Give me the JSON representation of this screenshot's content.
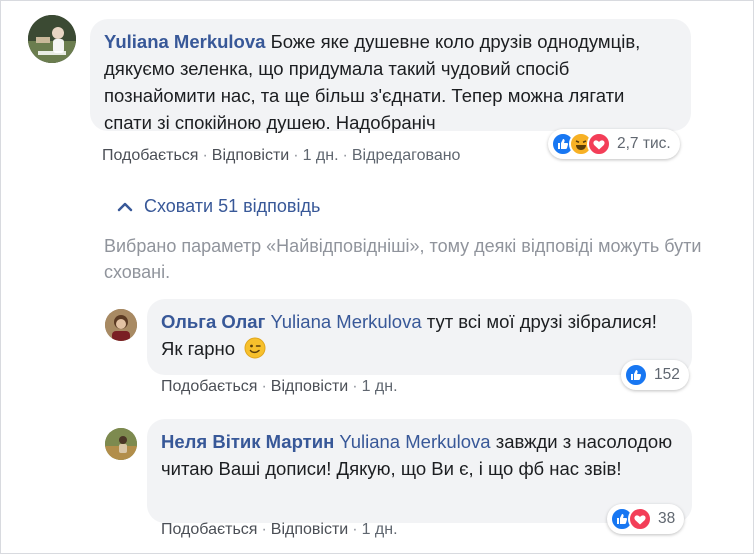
{
  "comment": {
    "author": "Yuliana Merkulova",
    "text": "Боже яке душевне коло друзів однодумців, дякуємо зеленка, що придумала такий чудовий спосіб познайомити нас, та ще більш з'єднати. Тепер можна лягати спати зі спокійною душею. Надобраніч",
    "like_label": "Подобається",
    "reply_label": "Відповісти",
    "time": "1 дн.",
    "edited": "Відредаговано",
    "reaction_count": "2,7 тис.",
    "reaction_icons": [
      "like-icon",
      "haha-icon",
      "love-icon"
    ]
  },
  "replies_toggle": {
    "label": "Сховати 51 відповідь",
    "icon": "chevron-up-icon"
  },
  "filter_notice": "Вибрано параметр «Найвідповідніші», тому деякі відповіді можуть бути сховані.",
  "replies": [
    {
      "author": "Ольга Олаг",
      "mention": "Yuliana Merkulova",
      "text": "тут всі мої друзі зібралися!Як гарно",
      "emoji": "wink-emoji",
      "like_label": "Подобається",
      "reply_label": "Відповісти",
      "time": "1 дн.",
      "reaction_count": "152",
      "reaction_icons": [
        "like-icon"
      ]
    },
    {
      "author": "Неля Вітик Мартин",
      "mention": "Yuliana Merkulova",
      "text": "завжди з насолодою читаю Ваші дописи! Дякую, що Ви є, і що фб нас звів!",
      "like_label": "Подобається",
      "reply_label": "Відповісти",
      "time": "1 дн.",
      "reaction_count": "38",
      "reaction_icons": [
        "like-icon",
        "love-icon"
      ]
    }
  ],
  "colors": {
    "link": "#385898",
    "bubble": "#f2f3f5",
    "meta": "#606770",
    "like": "#1877f2",
    "love": "#f33e58",
    "haha": "#f7b125"
  }
}
